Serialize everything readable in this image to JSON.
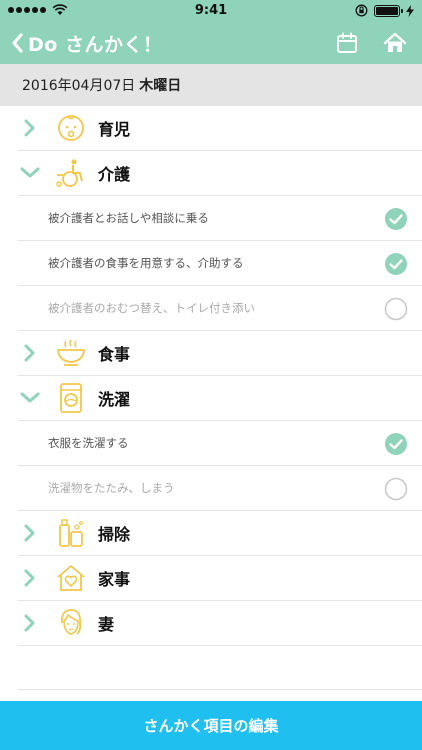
{
  "status_bar": {
    "time": "9:41"
  },
  "nav": {
    "title": "Do さんかく！"
  },
  "date": {
    "text": "2016年04月07日",
    "weekday": "木曜日"
  },
  "categories": [
    {
      "label": "育児",
      "expanded": false,
      "icon": "baby-icon"
    },
    {
      "label": "介護",
      "expanded": true,
      "icon": "wheelchair-icon",
      "tasks": [
        {
          "label": "被介護者とお話しや相談に乗る",
          "checked": true
        },
        {
          "label": "被介護者の食事を用意する、介助する",
          "checked": true
        },
        {
          "label": "被介護者のおむつ替え、トイレ付き添い",
          "checked": false
        }
      ]
    },
    {
      "label": "食事",
      "expanded": false,
      "icon": "bowl-icon"
    },
    {
      "label": "洗濯",
      "expanded": true,
      "icon": "washing-machine-icon",
      "tasks": [
        {
          "label": "衣服を洗濯する",
          "checked": true
        },
        {
          "label": "洗濯物をたたみ、しまう",
          "checked": false
        }
      ]
    },
    {
      "label": "掃除",
      "expanded": false,
      "icon": "cleaning-bottles-icon"
    },
    {
      "label": "家事",
      "expanded": false,
      "icon": "house-heart-icon"
    },
    {
      "label": "妻",
      "expanded": false,
      "icon": "wife-icon"
    }
  ],
  "footer": {
    "edit_button": "さんかく項目の編集"
  },
  "colors": {
    "header": "#8fd3bb",
    "accent": "#1fbfef",
    "check": "#8fd3bb",
    "icon": "#f2c84b"
  }
}
